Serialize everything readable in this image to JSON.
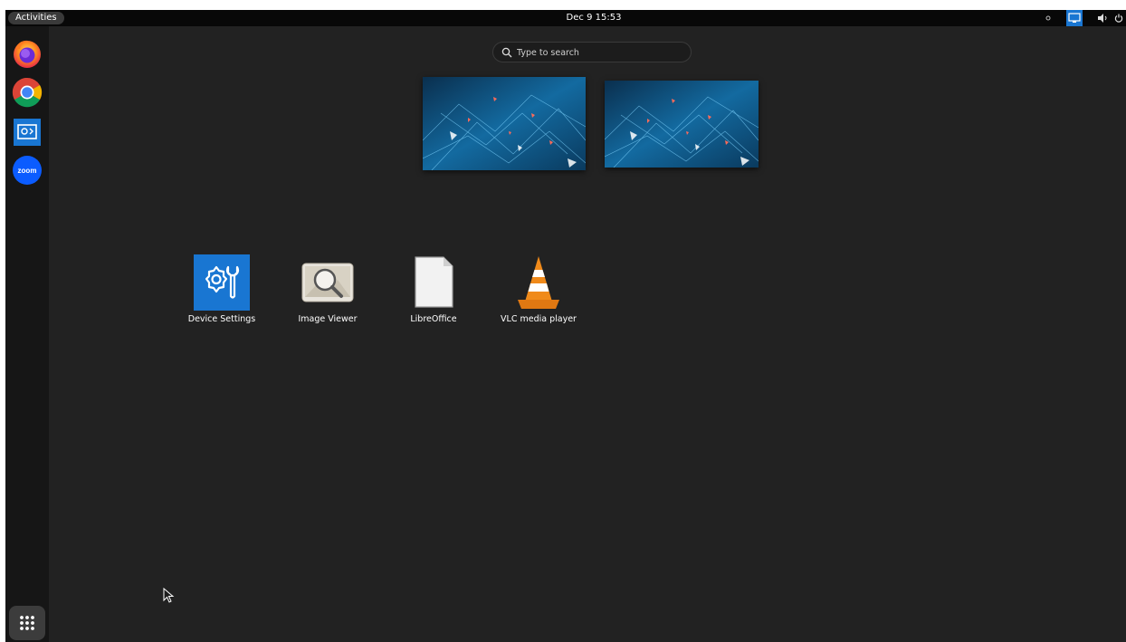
{
  "topbar": {
    "activities_label": "Activities",
    "clock": "Dec 9  15:53",
    "tray_icons": [
      "notification-dot-icon",
      "screen-share-icon",
      "volume-icon",
      "power-icon"
    ]
  },
  "dash": {
    "apps": [
      {
        "name": "Firefox",
        "icon": "firefox-icon"
      },
      {
        "name": "Google Chrome",
        "icon": "chrome-icon"
      },
      {
        "name": "Remote Desktop",
        "icon": "remote-desktop-icon"
      },
      {
        "name": "Zoom",
        "icon": "zoom-icon",
        "icon_text": "zoom"
      }
    ],
    "show_apps_icon": "app-grid-icon"
  },
  "search": {
    "placeholder": "Type to search"
  },
  "workspaces": [
    "workspace-1",
    "workspace-2"
  ],
  "app_grid": [
    {
      "label": "Device Settings",
      "icon": "device-settings-icon"
    },
    {
      "label": "Image Viewer",
      "icon": "image-viewer-icon"
    },
    {
      "label": "LibreOffice",
      "icon": "libreoffice-icon"
    },
    {
      "label": "VLC media player",
      "icon": "vlc-icon"
    }
  ],
  "colors": {
    "screen_bg": "#222222",
    "topbar_bg": "#080808",
    "dash_bg": "#161616",
    "accent_blue": "#1976d2",
    "vlc_orange": "#f08a1a"
  }
}
